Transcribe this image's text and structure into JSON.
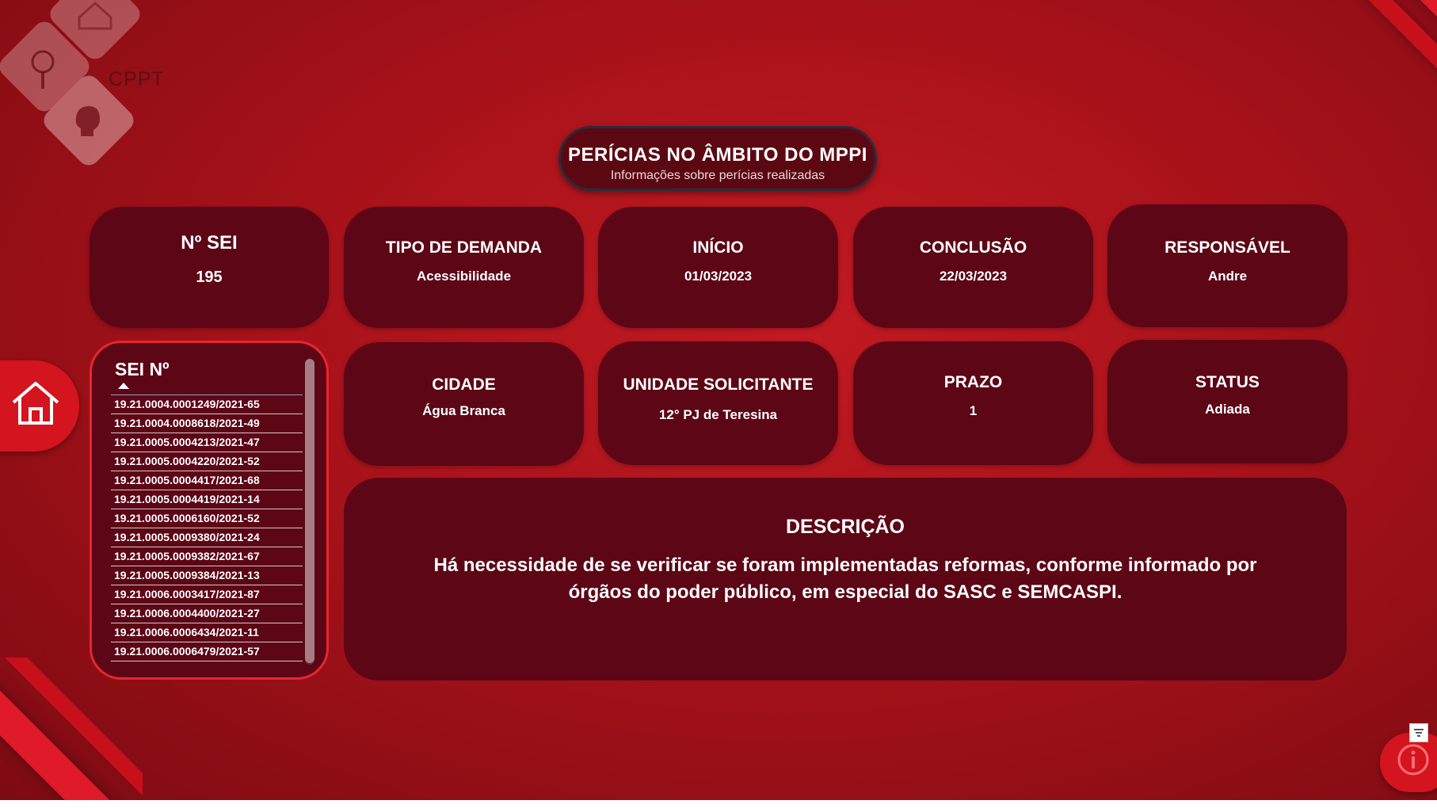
{
  "brand": {
    "logo_text": "CPPT"
  },
  "header": {
    "title": "PERÍCIAS NO ÂMBITO DO MPPI",
    "subtitle": "Informações sobre perícias realizadas"
  },
  "cards": {
    "sei": {
      "label": "Nº SEI",
      "value": "195"
    },
    "tipo": {
      "label": "TIPO DE DEMANDA",
      "value": "Acessibilidade"
    },
    "inicio": {
      "label": "INÍCIO",
      "value": "01/03/2023"
    },
    "conclusao": {
      "label": "CONCLUSÃO",
      "value": "22/03/2023"
    },
    "responsavel": {
      "label": "RESPONSÁVEL",
      "value": "Andre"
    },
    "cidade": {
      "label": "CIDADE",
      "value": "Água Branca"
    },
    "unidade": {
      "label": "UNIDADE SOLICITANTE",
      "value": "12° PJ de Teresina"
    },
    "prazo": {
      "label": "PRAZO",
      "value": "1"
    },
    "status": {
      "label": "STATUS",
      "value": "Adiada"
    }
  },
  "sei_list": {
    "header": "SEI Nº",
    "sort": "ascending",
    "items": [
      "19.21.0004.0001249/2021-65",
      "19.21.0004.0008618/2021-49",
      "19.21.0005.0004213/2021-47",
      "19.21.0005.0004220/2021-52",
      "19.21.0005.0004417/2021-68",
      "19.21.0005.0004419/2021-14",
      "19.21.0005.0006160/2021-52",
      "19.21.0005.0009380/2021-24",
      "19.21.0005.0009382/2021-67",
      "19.21.0005.0009384/2021-13",
      "19.21.0006.0003417/2021-87",
      "19.21.0006.0004400/2021-27",
      "19.21.0006.0006434/2021-11",
      "19.21.0006.0006479/2021-57"
    ]
  },
  "descricao": {
    "label": "DESCRIÇÃO",
    "text": "Há necessidade de se verificar se foram implementadas reformas, conforme informado por órgãos do poder público, em especial do SASC e SEMCASPI."
  },
  "icons": {
    "home": "home-icon",
    "info": "info-icon",
    "filter": "filter-icon",
    "magnifier": "magnifier-icon",
    "head": "head-icon",
    "house_outline": "house-outline-icon"
  },
  "colors": {
    "background": "#b3141c",
    "card": "#5c0616",
    "accent": "#e01a28",
    "title_border": "#2a2d3a"
  }
}
